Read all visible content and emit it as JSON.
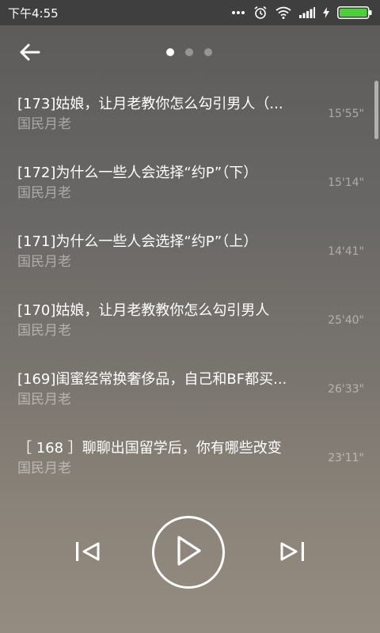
{
  "status_bar": {
    "time": "下午4:55"
  },
  "header": {
    "back_icon": "arrow-left-icon",
    "page_dots": 3,
    "active_dot": 0
  },
  "tracks": [
    {
      "title": "[173]姑娘，让月老教你怎么勾引男人（...",
      "artist": "国民月老",
      "duration": "15'55\""
    },
    {
      "title": "[172]为什么一些人会选择“约P”（下）",
      "artist": "国民月老",
      "duration": "15'14\""
    },
    {
      "title": "[171]为什么一些人会选择“约P”（上）",
      "artist": "国民月老",
      "duration": "14'41\""
    },
    {
      "title": "[170]姑娘，让月老教教你怎么勾引男人",
      "artist": "国民月老",
      "duration": "25'40\""
    },
    {
      "title": "[169]闺蜜经常换奢侈品，自己和BF都买...",
      "artist": "国民月老",
      "duration": "26'33\""
    },
    {
      "title": "［ 168 ］聊聊出国留学后，你有哪些改变",
      "artist": "国民月老",
      "duration": "23'11\""
    }
  ],
  "controls": {
    "prev_icon": "skip-previous-icon",
    "play_icon": "play-icon",
    "next_icon": "skip-next-icon"
  }
}
